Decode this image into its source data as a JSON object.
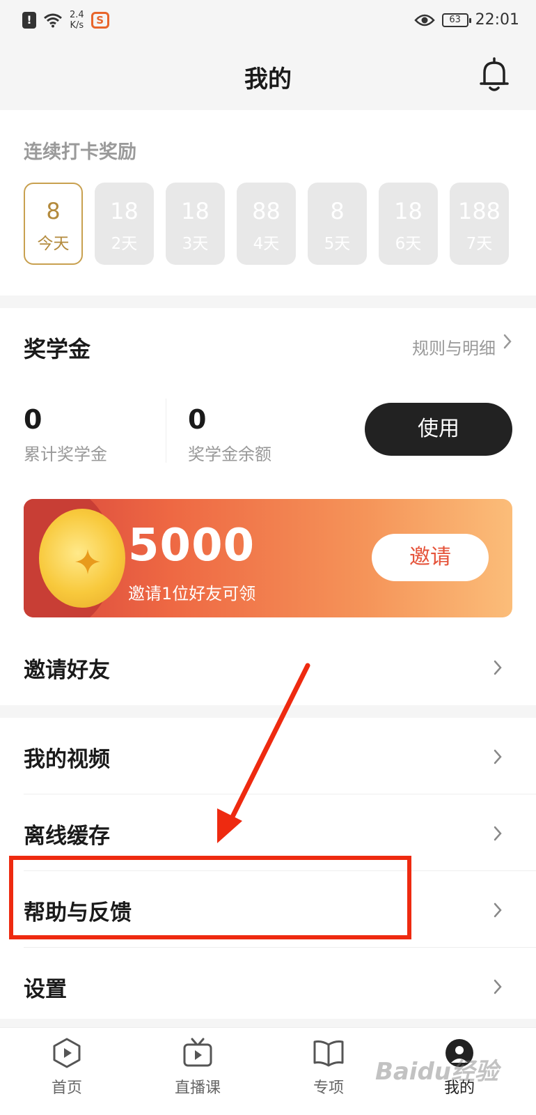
{
  "status_bar": {
    "speed_value": "2.4",
    "speed_unit": "K/s",
    "battery": "63",
    "time": "22:01"
  },
  "header": {
    "title": "我的"
  },
  "checkin": {
    "title": "连续打卡奖励",
    "days": [
      {
        "amount": "8",
        "label": "今天"
      },
      {
        "amount": "18",
        "label": "2天"
      },
      {
        "amount": "18",
        "label": "3天"
      },
      {
        "amount": "88",
        "label": "4天"
      },
      {
        "amount": "8",
        "label": "5天"
      },
      {
        "amount": "18",
        "label": "6天"
      },
      {
        "amount": "188",
        "label": "7天"
      }
    ]
  },
  "scholarship": {
    "title": "奖学金",
    "rules_link": "规则与明细",
    "total_value": "0",
    "total_label": "累计奖学金",
    "balance_value": "0",
    "balance_label": "奖学金余额",
    "use_button": "使用",
    "banner": {
      "amount": "5000",
      "subtitle": "邀请1位好友可领",
      "invite_button": "邀请"
    },
    "invite_friends": "邀请好友"
  },
  "menu": {
    "items": [
      {
        "label": "我的视频"
      },
      {
        "label": "离线缓存"
      },
      {
        "label": "帮助与反馈"
      },
      {
        "label": "设置"
      }
    ]
  },
  "tabbar": {
    "tabs": [
      {
        "label": "首页"
      },
      {
        "label": "直播课"
      },
      {
        "label": "专项"
      },
      {
        "label": "我的"
      }
    ]
  },
  "watermark": "Baidu经验",
  "colors": {
    "accent_gold": "#b38a3c",
    "invite_red": "#e5533a",
    "highlight_red": "#ee2a10"
  }
}
